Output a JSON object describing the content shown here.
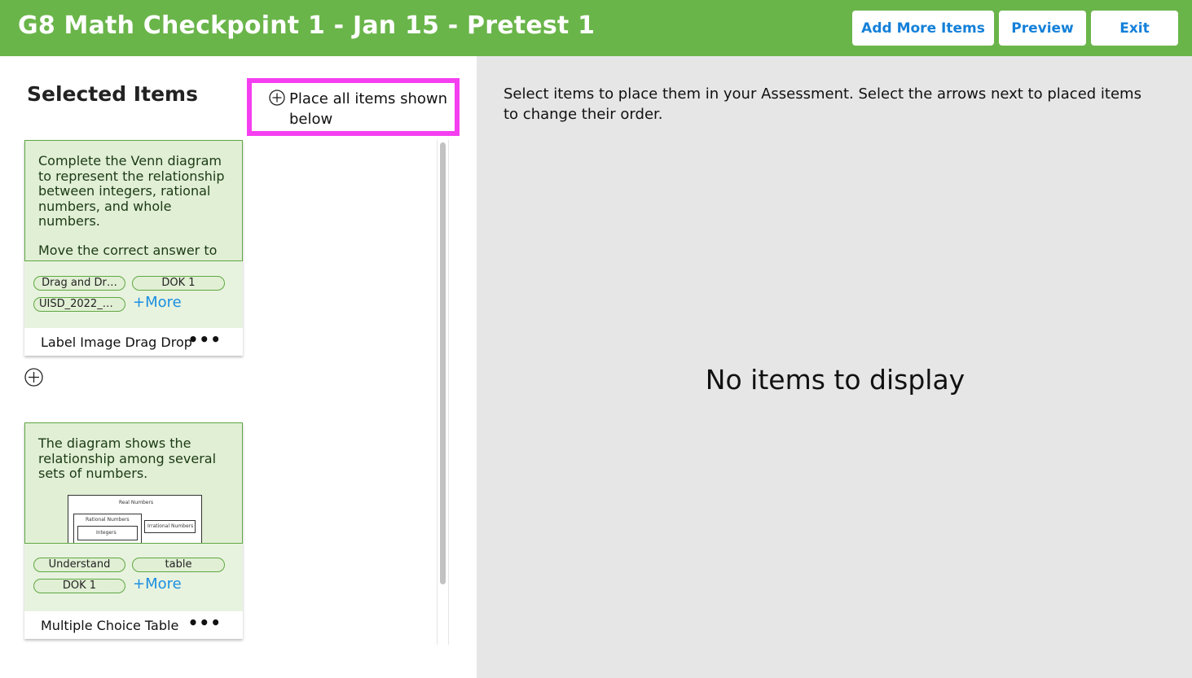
{
  "header": {
    "title": "G8 Math Checkpoint 1 - Jan 15 - Pretest 1",
    "add_more_label": "Add More Items",
    "preview_label": "Preview",
    "exit_label": "Exit",
    "bg_color": "#6ab54a",
    "button_text_color": "#1480d9"
  },
  "left": {
    "title": "Selected Items",
    "place_all_label": "Place all items shown below",
    "highlight_color": "#f53ef0",
    "items": [
      {
        "preview_text_1": "Complete the Venn diagram to represent the relationship between integers, rational numbers, and whole numbers.",
        "preview_text_2": "Move the correct answer to",
        "tags": [
          "Drag and Dr…",
          "DOK 1",
          "UISD_2022_G…"
        ],
        "more_label": "+More",
        "type": "Label Image Drag Drop",
        "menu_label": "•••"
      },
      {
        "preview_text_1": "The diagram shows the relationship among several sets of numbers.",
        "diagram": {
          "outer_label": "Real Numbers",
          "rational_label": "Rational Numbers",
          "integers_label": "Integers",
          "irrational_label": "Irrational Numbers"
        },
        "tags": [
          "Understand",
          "table",
          "DOK 1"
        ],
        "more_label": "+More",
        "type": "Multiple Choice Table",
        "menu_label": "•••"
      }
    ]
  },
  "right": {
    "instructions": "Select items to place them in your Assessment. Select the arrows next to placed items to change their order.",
    "empty_message": "No items to display"
  },
  "icons": {
    "place_all": "plus-circle-icon",
    "add_between": "plus-circle-icon",
    "item_menu": "more-horizontal-icon"
  }
}
